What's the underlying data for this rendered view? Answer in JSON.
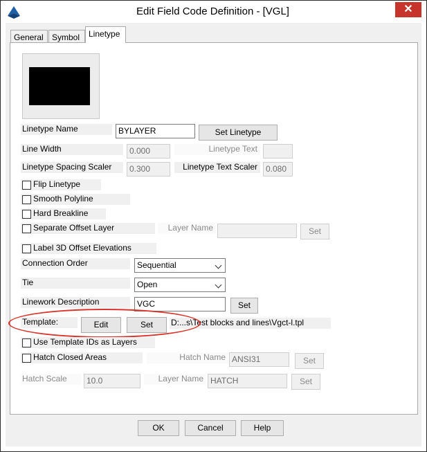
{
  "window": {
    "title": "Edit Field Code Definition - [VGL]",
    "close_label": "✕"
  },
  "tabs": [
    {
      "label": "General"
    },
    {
      "label": "Symbol"
    },
    {
      "label": "Linetype"
    }
  ],
  "linetype": {
    "linetype_name_label": "Linetype Name",
    "linetype_name_value": "BYLAYER",
    "set_linetype_label": "Set Linetype",
    "line_width_label": "Line Width",
    "line_width_value": "0.000",
    "linetype_text_label": "Linetype Text",
    "linetype_text_value": "",
    "spacing_scaler_label": "Linetype Spacing Scaler",
    "spacing_scaler_value": "0.300",
    "text_scaler_label": "Linetype Text Scaler",
    "text_scaler_value": "0.080",
    "flip_label": "Flip Linetype",
    "smooth_label": "Smooth Polyline",
    "hard_break_label": "Hard Breakline",
    "separate_offset_label": "Separate Offset Layer",
    "layer_name_label": "Layer Name",
    "layer_name_value": "",
    "layer_set_label": "Set",
    "label_3d_label": "Label 3D Offset Elevations",
    "connection_order_label": "Connection Order",
    "connection_order_value": "Sequential",
    "tie_label": "Tie",
    "tie_value": "Open",
    "linework_desc_label": "Linework Description",
    "linework_desc_value": "VGC",
    "linework_set_label": "Set",
    "template_label": "Template:",
    "template_edit_label": "Edit",
    "template_set_label": "Set",
    "template_path": "D:...s\\Test blocks and lines\\Vgct-l.tpl",
    "use_template_ids_label": "Use Template IDs as Layers",
    "hatch_closed_label": "Hatch Closed Areas",
    "hatch_name_label": "Hatch Name",
    "hatch_name_value": "ANSI31",
    "hatch_set_label": "Set",
    "hatch_scale_label": "Hatch Scale",
    "hatch_scale_value": "10.0",
    "hatch_layer_label": "Layer Name",
    "hatch_layer_value": "HATCH",
    "hatch_layer_set_label": "Set"
  },
  "footer": {
    "ok_label": "OK",
    "cancel_label": "Cancel",
    "help_label": "Help"
  },
  "colors": {
    "highlight_oval": "#d9332b",
    "close_button": "#c7342b",
    "app_icon": "#1f5fa8"
  }
}
